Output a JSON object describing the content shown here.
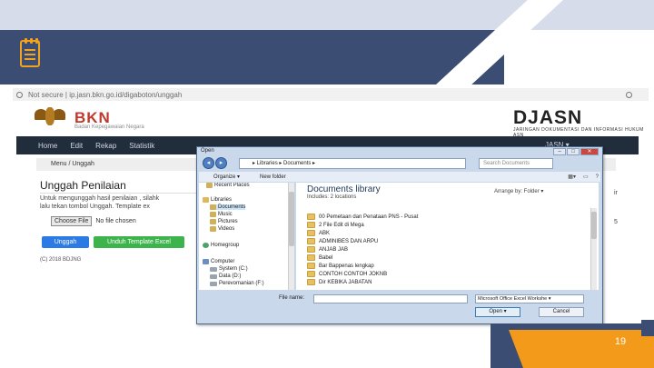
{
  "slide": {
    "page_number": "19",
    "colors": {
      "navy": "#3b4d72",
      "light": "#d6dcea",
      "accent": "#f39a1a"
    },
    "icon": "notes-icon"
  },
  "browser": {
    "address": "Not secure | ip.jasn.bkn.go.id/digaboton/unggah",
    "bkn_title": "BKN",
    "bkn_sub": "Badan Kepegawaian Negara",
    "djasn_title": "DJASN",
    "djasn_sub": "JARINGAN DOKUMENTASI DAN INFORMASI HUKUM ASN",
    "nav": [
      "Home",
      "Edit",
      "Rekap",
      "Statistik"
    ],
    "nav_right": "JASN ▾",
    "breadcrumb": "Menu  /  Unggah",
    "page_title": "Unggah Penilaian",
    "desc_line1": "Untuk mengunggah hasil penilaian , silahk",
    "desc_line2": "lalu tekan tombol Unggah. Template ex",
    "desc_right1": "ir",
    "desc_right2": "5",
    "choose_file": "Choose File",
    "no_file": "No file chosen",
    "upload_button": "Unggah",
    "template_button": "Unduh Template Excel",
    "copyright": "(C) 2018 BDJNG"
  },
  "dialog": {
    "title": "Open",
    "path": "▸  Libraries  ▸  Documents  ▸",
    "search_placeholder": "Search Documents",
    "toolbar": [
      "Organize ▾",
      "New folder"
    ],
    "nav_items": [
      {
        "label": "Recent Places",
        "icon": "folder-icon"
      },
      {
        "label": "Libraries",
        "icon": "library-icon"
      },
      {
        "label": "Documents",
        "icon": "folder-icon"
      },
      {
        "label": "Music",
        "icon": "folder-icon"
      },
      {
        "label": "Pictures",
        "icon": "folder-icon"
      },
      {
        "label": "Videos",
        "icon": "folder-icon"
      },
      {
        "label": "Homegroup",
        "icon": "homegroup-icon"
      },
      {
        "label": "Computer",
        "icon": "computer-icon"
      },
      {
        "label": "System (C:)",
        "icon": "drive-icon"
      },
      {
        "label": "Data (D:)",
        "icon": "drive-icon"
      },
      {
        "label": "Perevomanian (F:)",
        "icon": "drive-icon"
      }
    ],
    "library_title": "Documents library",
    "library_sub": "Includes: 2 locations",
    "arrange": "Arrange by:   Folder ▾",
    "folders": [
      "00 Pemetaan dan Penataan PNS - Pusat",
      "2 File Edit di Mega",
      "ABK",
      "ADMINIBES DAN ARPU",
      "ANJAB JAB",
      "Babel",
      "Bar Bappenas lengkap",
      "CONTOH CONTOH JOKNB",
      "Dir KEBIKA JABATAN"
    ],
    "filename_label": "File name:",
    "filetype": "Microsoft Office Excel Workshe ▾",
    "open_button": "Open  ▾",
    "cancel_button": "Cancel"
  }
}
